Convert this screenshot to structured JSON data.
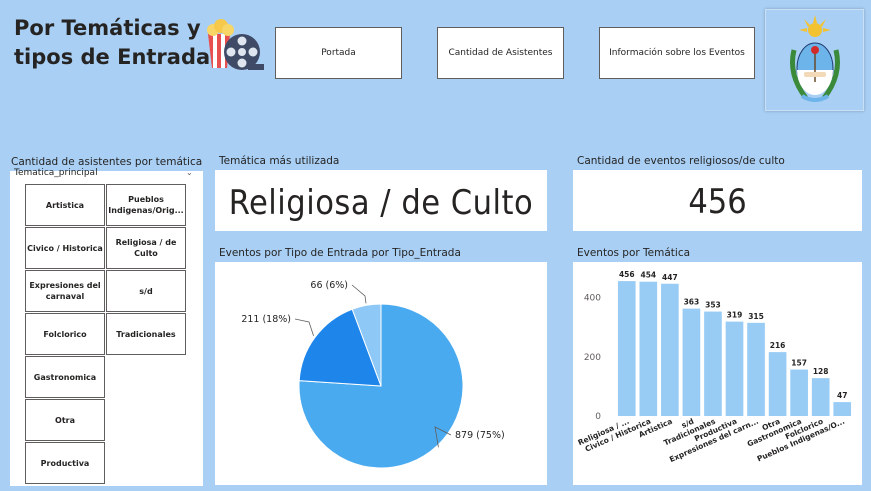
{
  "header": {
    "title_line1": "Por Temáticas y",
    "title_line2": "tipos de Entradas"
  },
  "nav": {
    "portada": "Portada",
    "asistentes": "Cantidad de Asistentes",
    "eventos": "Información sobre los Eventos"
  },
  "slicer": {
    "title": "Cantidad de asistentes por temática",
    "field": "Tematica_principal",
    "items": [
      "Artistica",
      "Pueblos Indigenas/Orig...",
      "Civico / Historica",
      "Religiosa / de Culto",
      "Expresiones del carnaval",
      "s/d",
      "Folclorico",
      "Tradicionales",
      "Gastronomica",
      "Otra",
      "Productiva"
    ]
  },
  "card_tematica": {
    "title": "Temática más utilizada",
    "value": "Religiosa / de Culto"
  },
  "card_religiosos": {
    "title": "Cantidad de eventos religiosos/de culto",
    "value": "456"
  },
  "pie_title": "Eventos por Tipo de Entrada por Tipo_Entrada",
  "bar_title": "Eventos por Temática",
  "colors": {
    "background": "#a9cff5",
    "pie_large": "#4aaaf0",
    "pie_mid": "#1e85ea",
    "pie_small": "#8ec8f7",
    "bar": "#99ccf5"
  },
  "chart_data": [
    {
      "type": "pie",
      "title": "Eventos por Tipo de Entrada por Tipo_Entrada",
      "slices": [
        {
          "value": 879,
          "label": "879 (75%)"
        },
        {
          "value": 211,
          "label": "211 (18%)"
        },
        {
          "value": 66,
          "label": "66 (6%)"
        }
      ]
    },
    {
      "type": "bar",
      "title": "Eventos por Temática",
      "categories": [
        "Religiosa / ...",
        "Civico / Historica",
        "Artistica",
        "s/d",
        "Tradicionales",
        "Productiva",
        "Expresiones del carn...",
        "Otra",
        "Gastronomica",
        "Folclorico",
        "Pueblos Indigenas/O..."
      ],
      "values": [
        456,
        454,
        447,
        363,
        353,
        319,
        315,
        216,
        157,
        128,
        47
      ],
      "yticks": [
        0,
        200,
        400
      ],
      "ylim": [
        0,
        480
      ]
    }
  ]
}
